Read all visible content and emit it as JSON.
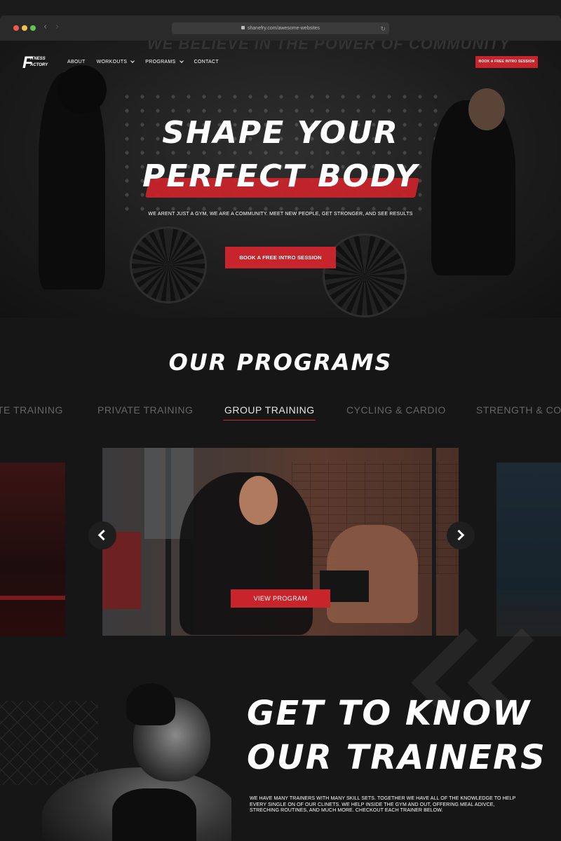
{
  "browser": {
    "url": "shanefry.com/awesome-websites"
  },
  "header": {
    "logo_text_big": "F",
    "logo_line1": "ITNESS",
    "logo_line2": "ACTORY",
    "nav": [
      {
        "label": "ABOUT"
      },
      {
        "label": "WORKOUTS"
      },
      {
        "label": "PROGRAMS"
      },
      {
        "label": "CONTACT"
      }
    ],
    "cta": "BOOK A FREE INTRO SESSION"
  },
  "hero": {
    "wall_text": "WE BELIEVE IN THE POWER OF COMMUNITY",
    "title_line1": "SHAPE YOUR",
    "title_line2": "PERFECT BODY",
    "subtitle": "WE ARENT JUST A GYM, WE ARE A COMMUNITY. MEET NEW PEOPLE, GET STRONGER, AND SEE RESULTS",
    "cta": "BOOK A FREE INTRO SESSION"
  },
  "programs": {
    "title": "OUR PROGRAMS",
    "tabs": [
      {
        "label": "TE TRAINING"
      },
      {
        "label": "PRIVATE TRAINING"
      },
      {
        "label": "GROUP TRAINING",
        "active": true
      },
      {
        "label": "CYCLING & CARDIO"
      },
      {
        "label": "STRENGTH & CON"
      }
    ],
    "slide_cta": "VIEW PROGRAM"
  },
  "trainers": {
    "title_line1": "GET TO KNOW",
    "title_line2": "OUR TRAINERS",
    "description": "WE HAVE MANY TRAINERS WITH MANY SKILL SETS. TOGETHER WE HAVE ALL OF THE KNOWLEDGE TO HELP EVERY SINGLE ON OF OUR CLINETS. WE HELP INSIDE THE GYM AND OUT, OFFERING MEAL ADIVCE, STRECHING ROUTINES, AND MUCH MORE. CHECKOUT EACH TRAINER BELOW."
  },
  "colors": {
    "accent": "#c8242b",
    "background": "#161616",
    "text": "#ffffff",
    "muted": "#666666"
  },
  "icons": [
    "lock-icon",
    "reload-icon",
    "back-icon",
    "forward-icon",
    "chevron-down-icon",
    "arrow-left-icon",
    "arrow-right-icon"
  ]
}
